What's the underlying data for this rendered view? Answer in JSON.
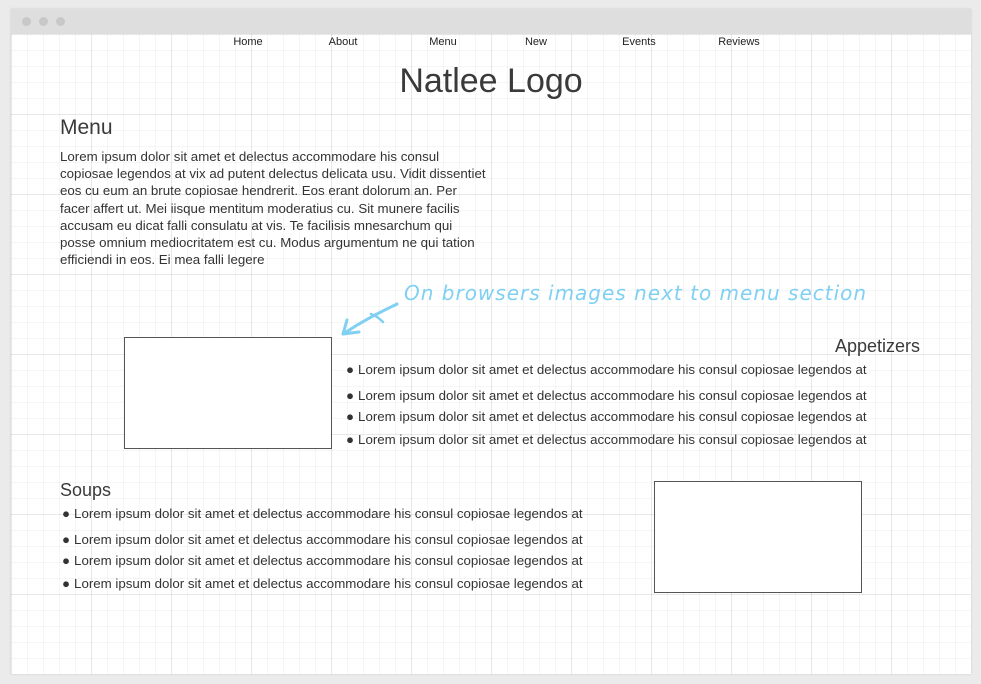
{
  "nav": [
    "Home",
    "About",
    "Menu",
    "New",
    "Events",
    "Reviews"
  ],
  "logo": "Natlee Logo",
  "menu_section": {
    "heading": "Menu",
    "body": "Lorem ipsum dolor sit amet et delectus accommodare his consul copiosae legendos at vix ad putent delectus delicata usu. Vidit dissentiet eos cu eum an brute copiosae hendrerit. Eos erant dolorum an. Per facer affert ut. Mei iisque mentitum moderatius cu. Sit munere facilis accusam eu dicat falli consulatu at vis. Te facilisis mnesarchum qui posse omnium mediocritatem est cu. Modus argumentum ne qui tation efficiendi in eos. Ei mea falli legere"
  },
  "annotation": "On browsers images next to menu section",
  "appetizers": {
    "heading": "Appetizers",
    "bullet": "●",
    "items": [
      "Lorem ipsum dolor sit amet et delectus accommodare his consul copiosae legendos at",
      "Lorem ipsum dolor sit amet et delectus accommodare his consul copiosae legendos at",
      "Lorem ipsum dolor sit amet et delectus accommodare his consul copiosae legendos at",
      "Lorem ipsum dolor sit amet et delectus accommodare his consul copiosae legendos at"
    ]
  },
  "soups": {
    "heading": "Soups",
    "bullet": "●",
    "items": [
      "Lorem ipsum dolor sit amet et delectus accommodare his consul copiosae legendos at",
      "Lorem ipsum dolor sit amet et delectus accommodare his consul copiosae legendos at",
      "Lorem ipsum dolor sit amet et delectus accommodare his consul copiosae legendos at",
      "Lorem ipsum dolor sit amet et delectus accommodare his consul copiosae legendos at"
    ]
  }
}
